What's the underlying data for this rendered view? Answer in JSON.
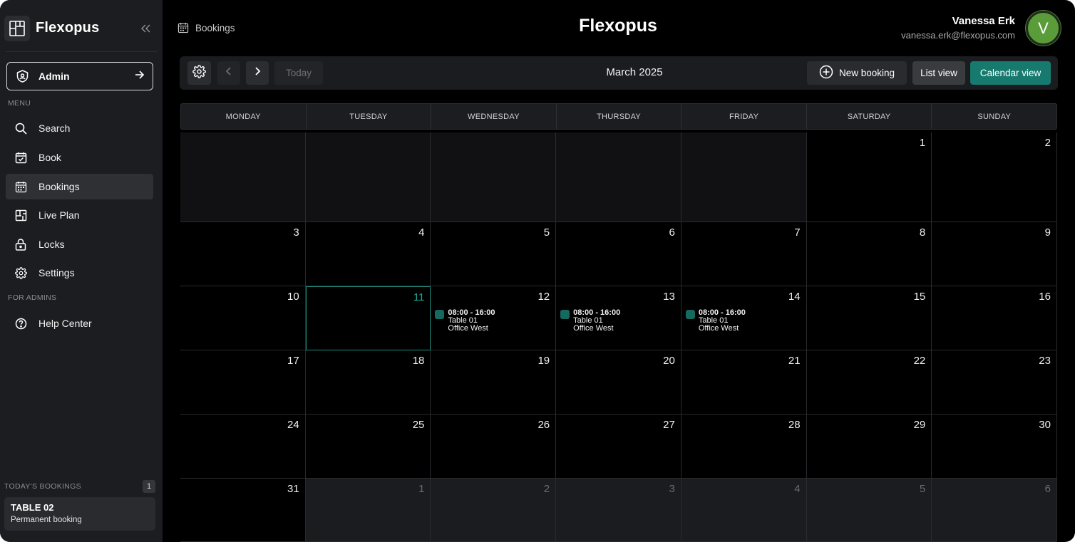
{
  "brand": {
    "name": "Flexopus"
  },
  "admin_button": {
    "label": "Admin"
  },
  "sidebar": {
    "menu_label": "MENU",
    "items": [
      {
        "label": "Search",
        "icon": "search-icon"
      },
      {
        "label": "Book",
        "icon": "calendar-check-icon"
      },
      {
        "label": "Bookings",
        "icon": "calendar-icon",
        "active": true
      },
      {
        "label": "Live Plan",
        "icon": "floor-plan-icon"
      },
      {
        "label": "Locks",
        "icon": "lock-icon"
      },
      {
        "label": "Settings",
        "icon": "gear-icon"
      }
    ],
    "admins_label": "FOR ADMINS",
    "admin_items": [
      {
        "label": "Help Center",
        "icon": "help-icon"
      }
    ],
    "todays_bookings": {
      "label": "TODAY'S BOOKINGS",
      "count": "1",
      "card_title": "TABLE 02",
      "card_subtitle": "Permanent booking"
    }
  },
  "header": {
    "breadcrumb": "Bookings",
    "app_title": "Flexopus",
    "user_name": "Vanessa Erk",
    "user_email": "vanessa.erk@flexopus.com",
    "avatar_initial": "V",
    "avatar_color": "#5b9c3a"
  },
  "toolbar": {
    "today_label": "Today",
    "month_label": "March 2025",
    "new_booking_label": "New booking",
    "list_view_label": "List view",
    "calendar_view_label": "Calendar view",
    "accent_color": "#167a6e"
  },
  "calendar": {
    "weekdays": [
      "MONDAY",
      "TUESDAY",
      "WEDNESDAY",
      "THURSDAY",
      "FRIDAY",
      "SATURDAY",
      "SUNDAY"
    ],
    "weeks": [
      [
        {
          "n": "",
          "o": "pre"
        },
        {
          "n": "",
          "o": "pre"
        },
        {
          "n": "",
          "o": "pre"
        },
        {
          "n": "",
          "o": "pre"
        },
        {
          "n": "",
          "o": "pre"
        },
        {
          "n": "1"
        },
        {
          "n": "2"
        }
      ],
      [
        {
          "n": "3"
        },
        {
          "n": "4"
        },
        {
          "n": "5"
        },
        {
          "n": "6"
        },
        {
          "n": "7"
        },
        {
          "n": "8"
        },
        {
          "n": "9"
        }
      ],
      [
        {
          "n": "10"
        },
        {
          "n": "11",
          "today": true
        },
        {
          "n": "12",
          "b": 0
        },
        {
          "n": "13",
          "b": 1
        },
        {
          "n": "14",
          "b": 2
        },
        {
          "n": "15"
        },
        {
          "n": "16"
        }
      ],
      [
        {
          "n": "17"
        },
        {
          "n": "18"
        },
        {
          "n": "19"
        },
        {
          "n": "20"
        },
        {
          "n": "21"
        },
        {
          "n": "22"
        },
        {
          "n": "23"
        }
      ],
      [
        {
          "n": "24"
        },
        {
          "n": "25"
        },
        {
          "n": "26"
        },
        {
          "n": "27"
        },
        {
          "n": "28"
        },
        {
          "n": "29"
        },
        {
          "n": "30"
        }
      ],
      [
        {
          "n": "31"
        },
        {
          "n": "1",
          "o": "post"
        },
        {
          "n": "2",
          "o": "post"
        },
        {
          "n": "3",
          "o": "post"
        },
        {
          "n": "4",
          "o": "post"
        },
        {
          "n": "5",
          "o": "post"
        },
        {
          "n": "6",
          "o": "post"
        }
      ]
    ],
    "bookings": [
      {
        "time": "08:00 - 16:00",
        "resource": "Table 01",
        "location": "Office West"
      },
      {
        "time": "08:00 - 16:00",
        "resource": "Table 01",
        "location": "Office West"
      },
      {
        "time": "08:00 - 16:00",
        "resource": "Table 01",
        "location": "Office West"
      }
    ]
  }
}
